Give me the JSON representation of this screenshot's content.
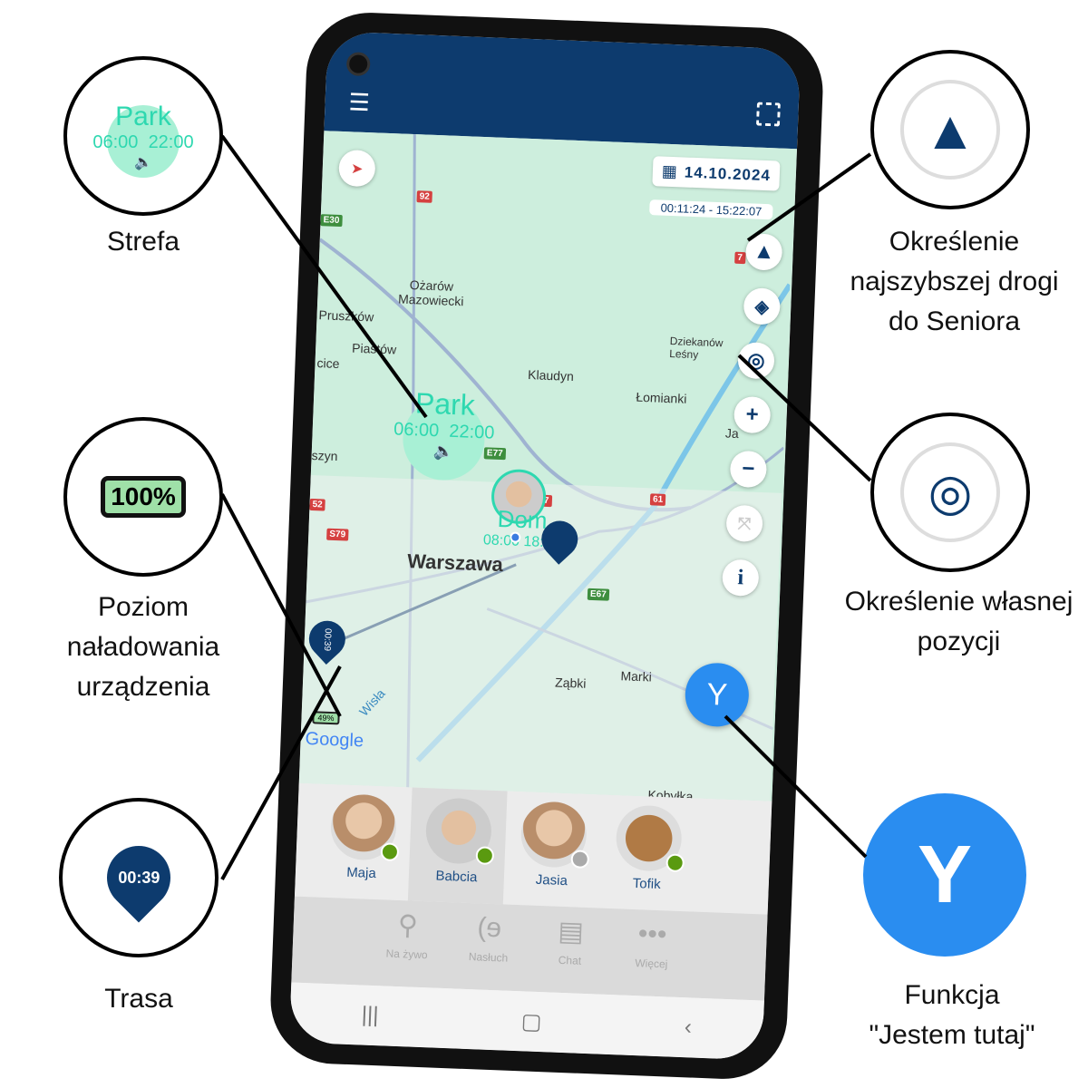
{
  "colors": {
    "header": "#0d3b6e",
    "zone": "#2ed8b0",
    "fab": "#2a8df0",
    "online": "#5a9a10",
    "offline": "#aaaaaa",
    "map": "#cdeedd"
  },
  "header": {
    "menu_icon": "hamburger-icon",
    "fullscreen_icon": "fullscreen-icon"
  },
  "date": {
    "value": "14.10.2024",
    "range": "00:11:24 - 15:22:07"
  },
  "map": {
    "labels": [
      "Ożarów Mazowiecki",
      "Pruszków",
      "Piastów",
      "cice",
      "Klaudyn",
      "Łomianki",
      "Dziekanów Leśny",
      "Ja",
      "szyn",
      "Warszawa",
      "Ząbki",
      "Marki",
      "Kobyłka",
      "Wisła"
    ],
    "shields": [
      "92",
      "E30",
      "E77",
      "7",
      "61",
      "S79",
      "E67",
      "52",
      "7"
    ],
    "zone": {
      "name": "Park",
      "start": "06:00",
      "end": "22:00"
    },
    "home": {
      "name": "Dom",
      "start": "08:00",
      "end": "18:00"
    },
    "route_marker": "00:39",
    "battery": "49%",
    "google": "Google"
  },
  "contacts": [
    {
      "name": "Maja",
      "online": true
    },
    {
      "name": "Babcia",
      "online": true,
      "selected": true
    },
    {
      "name": "Jasia",
      "online": false
    },
    {
      "name": "Tofik",
      "online": true
    }
  ],
  "bottom_nav": [
    {
      "label": "Na żywo",
      "icon": "live-tracking-icon"
    },
    {
      "label": "Nasłuch",
      "icon": "ear-icon"
    },
    {
      "label": "Chat",
      "icon": "chat-icon"
    },
    {
      "label": "Więcej",
      "icon": "more-icon"
    }
  ],
  "callouts": {
    "zone": {
      "title": "Park",
      "start": "06:00",
      "end": "22:00",
      "label": "Strefa"
    },
    "battery": {
      "value": "100%",
      "label": [
        "Poziom",
        "naładowania",
        "urządzenia"
      ]
    },
    "route": {
      "value": "00:39",
      "label": "Trasa"
    },
    "navigate": {
      "label": [
        "Określenie",
        "najszybszej drogi",
        "do Seniora"
      ]
    },
    "locate": {
      "label": [
        "Określenie własnej",
        "pozycji"
      ]
    },
    "here": {
      "label": [
        "Funkcja",
        "\"Jestem tutaj\""
      ]
    }
  }
}
